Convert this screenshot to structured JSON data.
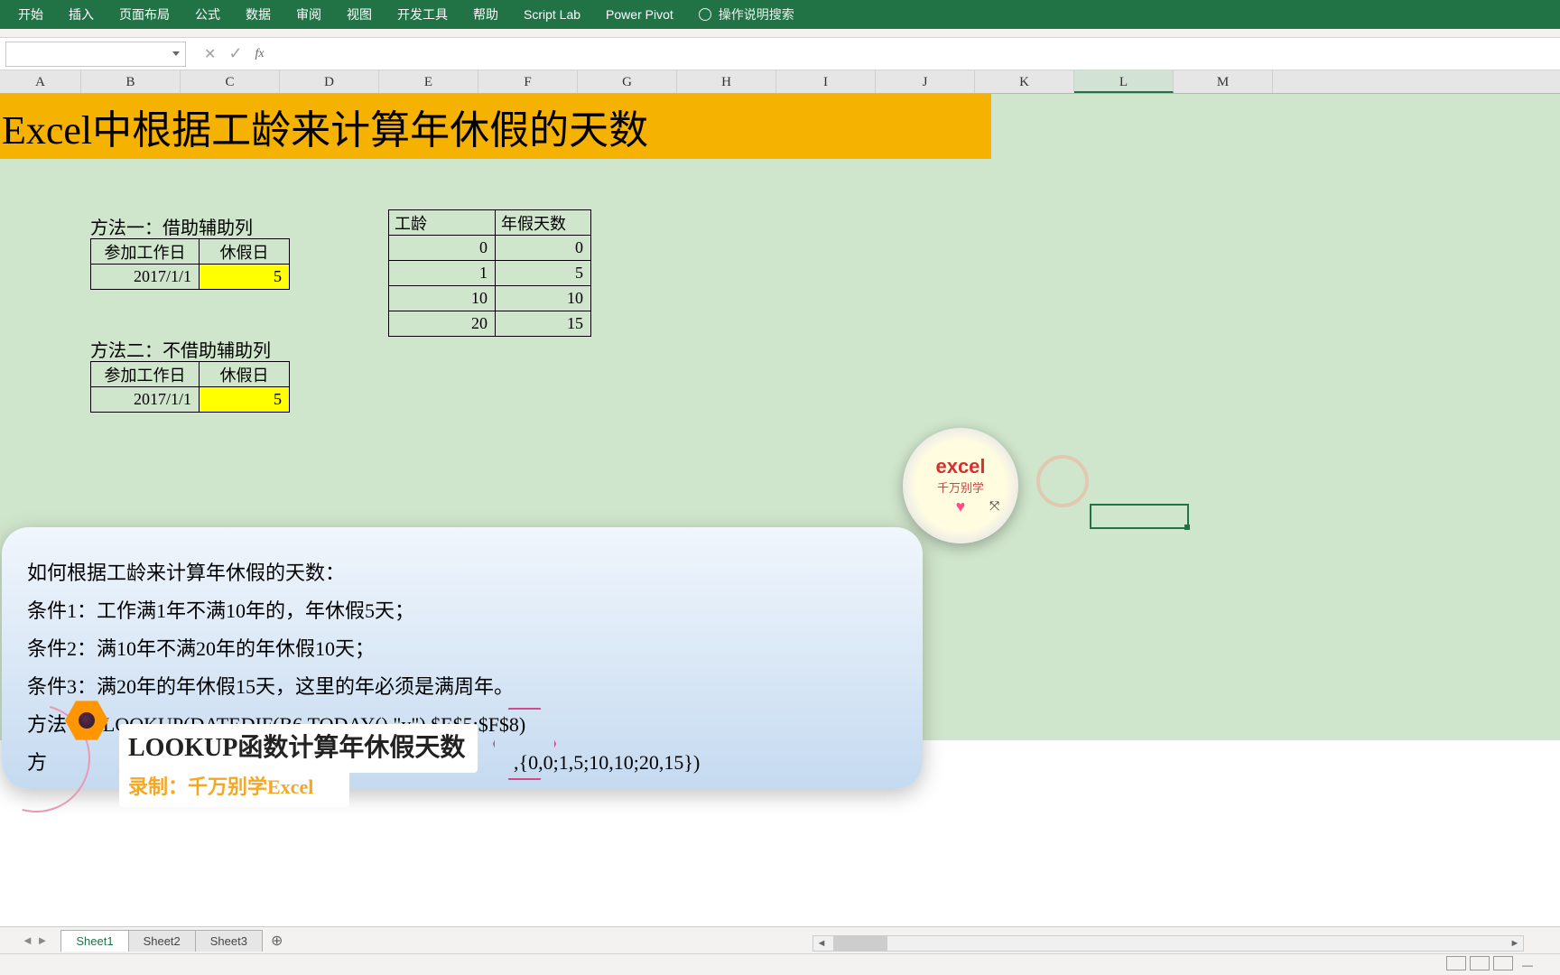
{
  "ribbon": [
    "开始",
    "插入",
    "页面布局",
    "公式",
    "数据",
    "审阅",
    "视图",
    "开发工具",
    "帮助",
    "Script Lab",
    "Power Pivot"
  ],
  "search_hint": "操作说明搜索",
  "columns": [
    "A",
    "B",
    "C",
    "D",
    "E",
    "F",
    "G",
    "H",
    "I",
    "J",
    "K",
    "L",
    "M"
  ],
  "active_col": "L",
  "title_text": "Excel中根据工龄来计算年休假的天数",
  "method1": {
    "caption": "方法一：借助辅助列",
    "h1": "参加工作日",
    "h2": "休假日",
    "v1": "2017/1/1",
    "v2": "5"
  },
  "method2": {
    "caption": "方法二：不借助辅助列",
    "h1": "参加工作日",
    "h2": "休假日",
    "v1": "2017/1/1",
    "v2": "5"
  },
  "lookup_table": {
    "h1": "工龄",
    "h2": "年假天数",
    "rows": [
      [
        "0",
        "0"
      ],
      [
        "1",
        "5"
      ],
      [
        "10",
        "10"
      ],
      [
        "20",
        "15"
      ]
    ]
  },
  "note": {
    "l1": "如何根据工龄来计算年休假的天数：",
    "l2": "条件1：工作满1年不满10年的，年休假5天；",
    "l3": "条件2：满10年不满20年的年休假10天；",
    "l4": "条件3：满20年的年休假15天，这里的年必须是满周年。",
    "l5a": "方法",
    "l5b": "=LOOKUP(DATEDIF(B6,TODAY(),\"y\"),$E$5:$F$8)",
    "l6a": "方",
    "l6b": ",{0,0;1,5;10,10;20,15})"
  },
  "badge": {
    "t1": "excel",
    "t2": "千万别学"
  },
  "overlay": {
    "title": "LOOKUP函数计算年休假天数",
    "sub": "录制：千万别学Excel"
  },
  "sheets": [
    "Sheet1",
    "Sheet2",
    "Sheet3"
  ],
  "active_sheet": "Sheet1",
  "chart_data": {
    "type": "table",
    "title": "工龄 → 年假天数",
    "columns": [
      "工龄",
      "年假天数"
    ],
    "rows": [
      [
        0,
        0
      ],
      [
        1,
        5
      ],
      [
        10,
        10
      ],
      [
        20,
        15
      ]
    ]
  }
}
